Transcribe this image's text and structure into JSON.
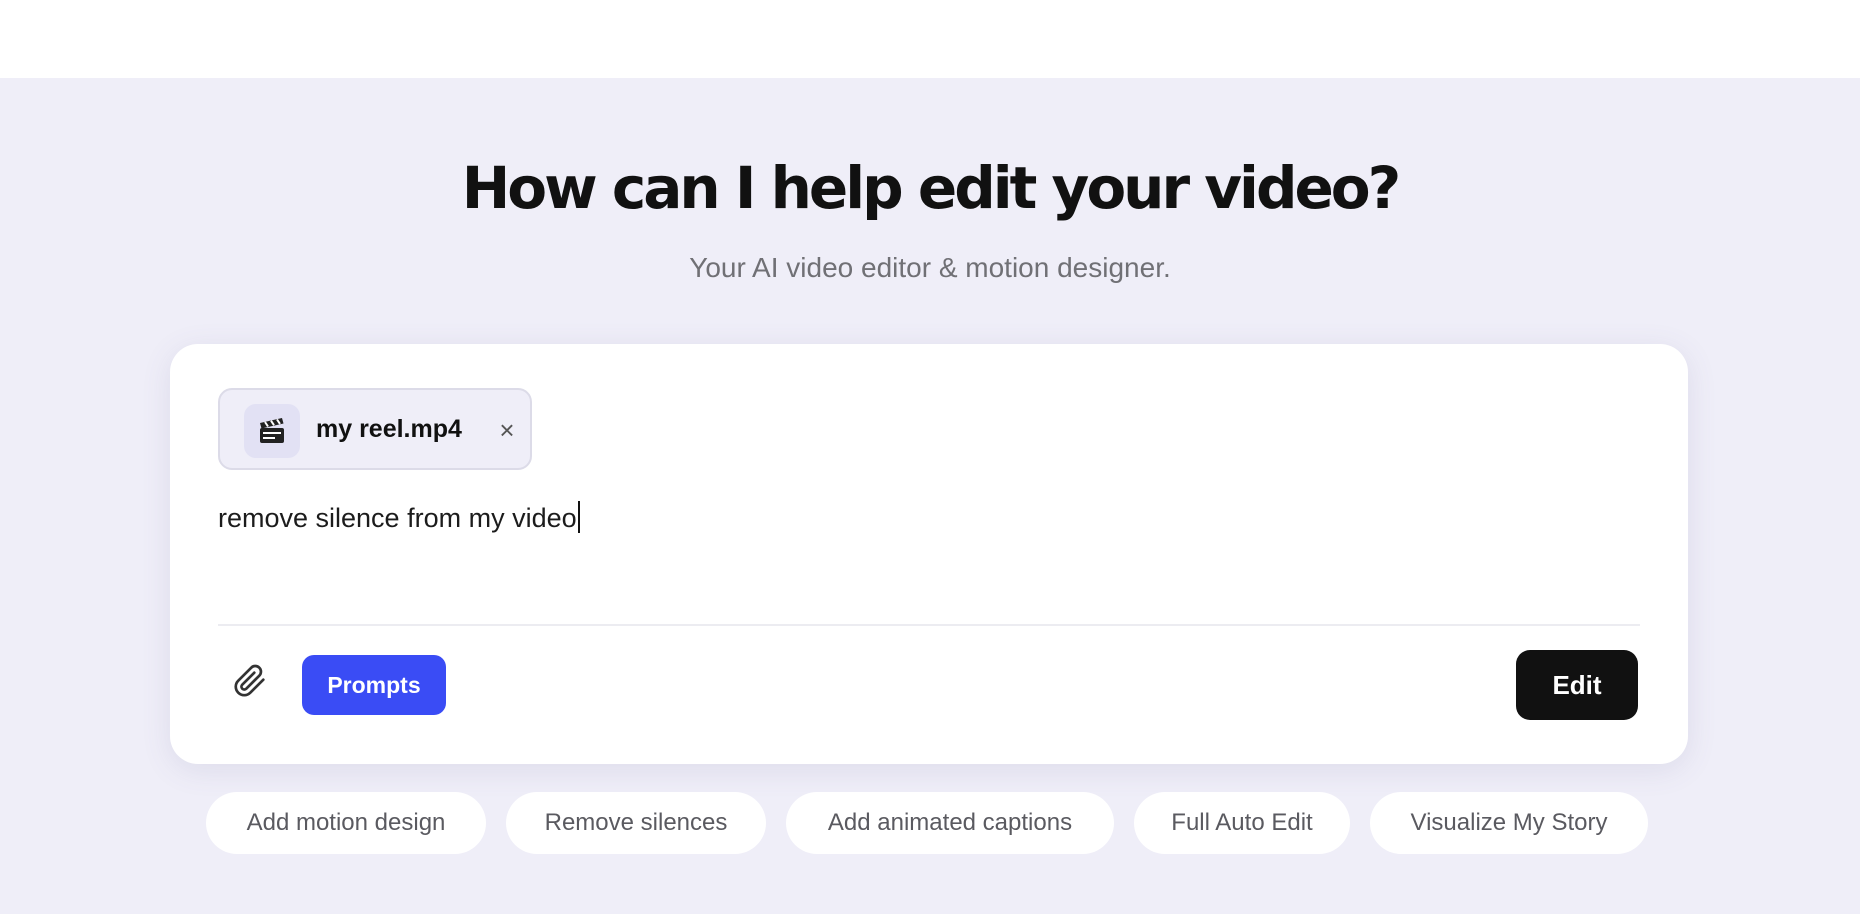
{
  "hero": {
    "title": "How can I help edit your video?",
    "subtitle": "Your AI video editor & motion designer."
  },
  "composer": {
    "attachment": {
      "icon": "clapperboard-icon",
      "filename": "my reel.mp4",
      "remove_label": "×"
    },
    "input_value": "remove silence from my video",
    "attach_icon": "paperclip-icon",
    "prompts_label": "Prompts",
    "submit_label": "Edit"
  },
  "suggestions": [
    {
      "label": "Add motion design"
    },
    {
      "label": "Remove silences"
    },
    {
      "label": "Add animated captions"
    },
    {
      "label": "Full Auto Edit"
    },
    {
      "label": "Visualize My Story"
    }
  ],
  "colors": {
    "background": "#efeef8",
    "card": "#ffffff",
    "accent": "#3a4cf5",
    "primary_button": "#111111"
  }
}
